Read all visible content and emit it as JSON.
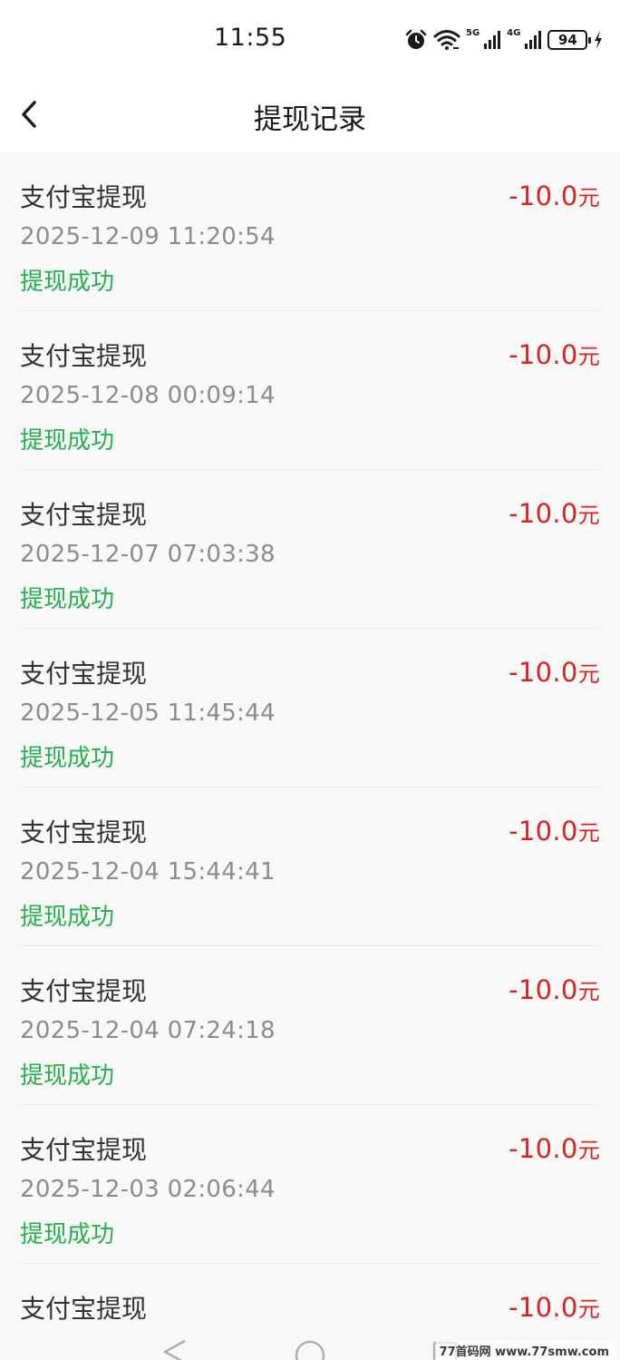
{
  "status_bar": {
    "time": "11:55",
    "net_5g": "5G",
    "net_4g": "4G",
    "battery": "94"
  },
  "header": {
    "title": "提现记录"
  },
  "records": [
    {
      "title": "支付宝提现",
      "time": "2025-12-09 11:20:54",
      "status": "提现成功",
      "amount": "-10.0",
      "unit": "元"
    },
    {
      "title": "支付宝提现",
      "time": "2025-12-08 00:09:14",
      "status": "提现成功",
      "amount": "-10.0",
      "unit": "元"
    },
    {
      "title": "支付宝提现",
      "time": "2025-12-07 07:03:38",
      "status": "提现成功",
      "amount": "-10.0",
      "unit": "元"
    },
    {
      "title": "支付宝提现",
      "time": "2025-12-05 11:45:44",
      "status": "提现成功",
      "amount": "-10.0",
      "unit": "元"
    },
    {
      "title": "支付宝提现",
      "time": "2025-12-04 15:44:41",
      "status": "提现成功",
      "amount": "-10.0",
      "unit": "元"
    },
    {
      "title": "支付宝提现",
      "time": "2025-12-04 07:24:18",
      "status": "提现成功",
      "amount": "-10.0",
      "unit": "元"
    },
    {
      "title": "支付宝提现",
      "time": "2025-12-03 02:06:44",
      "status": "提现成功",
      "amount": "-10.0",
      "unit": "元"
    },
    {
      "title": "支付宝提现",
      "time": "",
      "status": "",
      "amount": "-10.0",
      "unit": "元"
    }
  ],
  "watermark": "77首码网 www.77smw.com",
  "colors": {
    "amount": "#d9231f",
    "status_success": "#22b24c",
    "secondary_text": "#8c8c8c",
    "background": "#f8f8f8"
  },
  "icons": {
    "back": "chevron-left-icon",
    "alarm": "alarm-icon",
    "wifi": "wifi-icon",
    "signal": "signal-icon",
    "charging": "charging-bolt-icon"
  }
}
